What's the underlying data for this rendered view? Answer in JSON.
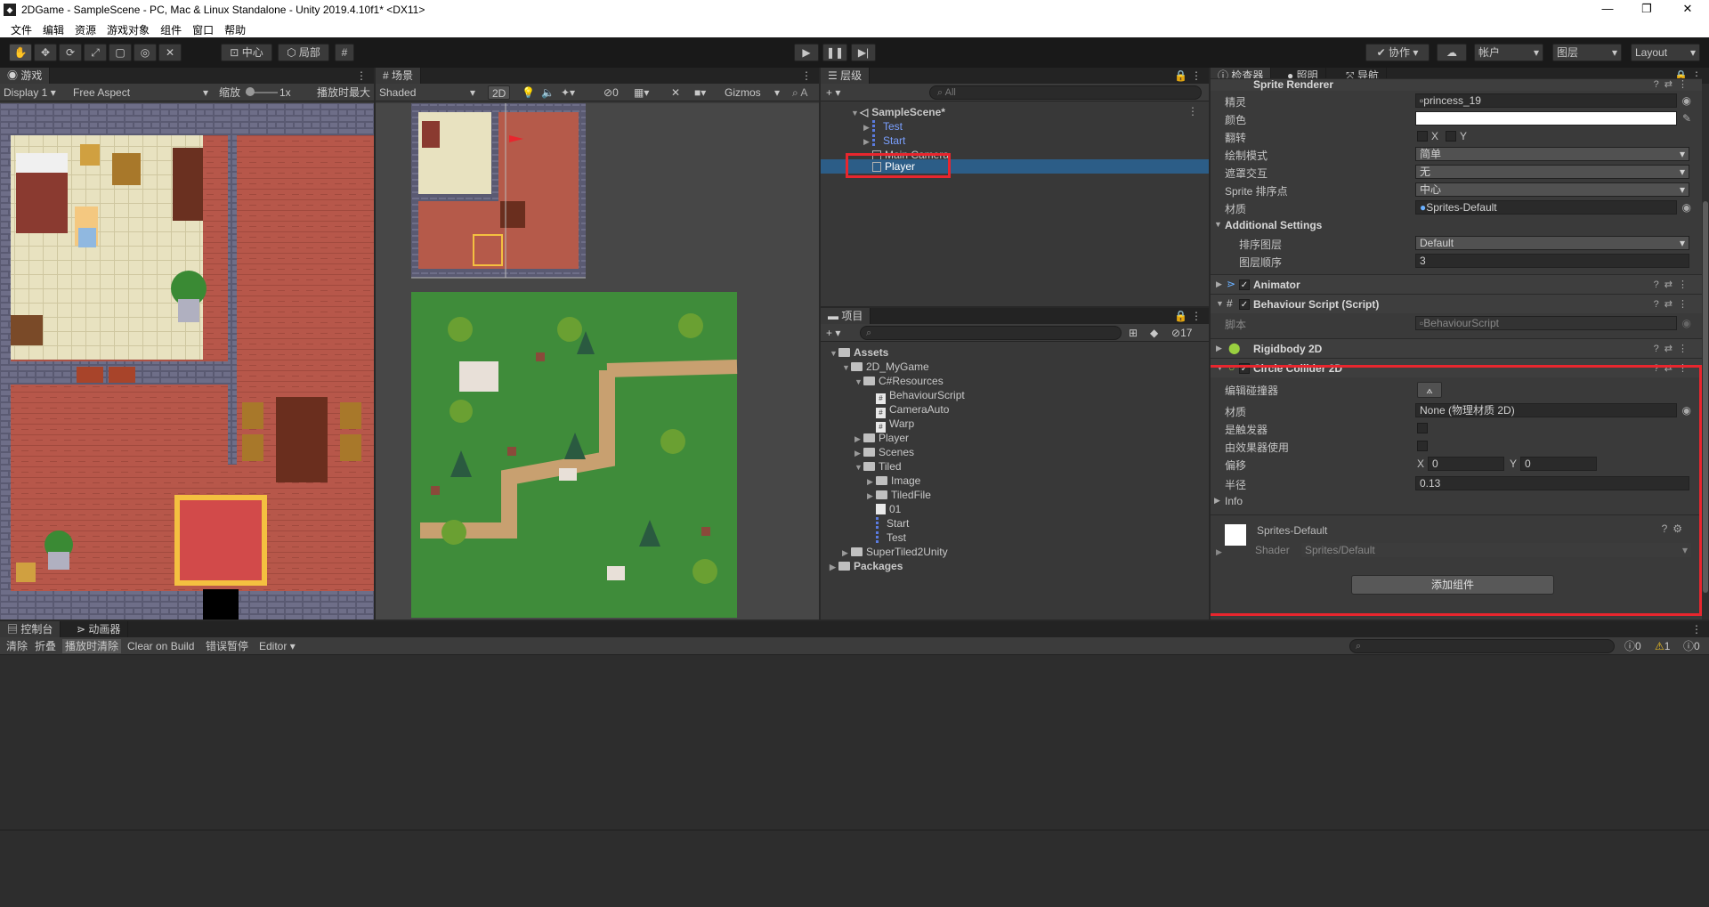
{
  "window": {
    "title": "2DGame - SampleScene - PC, Mac & Linux Standalone - Unity 2019.4.10f1* <DX11>",
    "app_icon": "unity-icon",
    "controls": [
      "—",
      "❐",
      "✕"
    ]
  },
  "menu": [
    "文件",
    "编辑",
    "资源",
    "游戏对象",
    "组件",
    "窗口",
    "帮助"
  ],
  "toolbar": {
    "pivot_label": "中心",
    "space_label": "局部",
    "collab_label": "协作",
    "account_label": "帐户",
    "layers_label": "图层",
    "layout_label": "Layout"
  },
  "game_panel": {
    "tab": "游戏",
    "display": "Display 1",
    "aspect": "Free Aspect",
    "scale_label": "缩放",
    "scale_value": "1x",
    "maximize": "播放时最大"
  },
  "scene_panel": {
    "tab": "场景",
    "shading": "Shaded",
    "mode_2d": "2D",
    "hidden_count": "0",
    "gizmos": "Gizmos",
    "search": "A"
  },
  "hierarchy": {
    "tab": "层级",
    "search_placeholder": "All",
    "scene": "SampleScene*",
    "items": [
      "Test",
      "Start",
      "Main Camera",
      "Player"
    ]
  },
  "project": {
    "tab": "项目",
    "badge": "17",
    "tree": [
      {
        "label": "Assets",
        "depth": 0,
        "open": true,
        "bold": true
      },
      {
        "label": "2D_MyGame",
        "depth": 1,
        "open": true
      },
      {
        "label": "C#Resources",
        "depth": 2,
        "open": true
      },
      {
        "label": "BehaviourScript",
        "depth": 3,
        "type": "script"
      },
      {
        "label": "CameraAuto",
        "depth": 3,
        "type": "script"
      },
      {
        "label": "Warp",
        "depth": 3,
        "type": "script"
      },
      {
        "label": "Player",
        "depth": 2,
        "open": false
      },
      {
        "label": "Scenes",
        "depth": 2,
        "open": false
      },
      {
        "label": "Tiled",
        "depth": 2,
        "open": true
      },
      {
        "label": "Image",
        "depth": 3,
        "open": false
      },
      {
        "label": "TiledFile",
        "depth": 3,
        "open": false
      },
      {
        "label": "01",
        "depth": 3,
        "type": "file"
      },
      {
        "label": "Start",
        "depth": 3,
        "type": "prefab"
      },
      {
        "label": "Test",
        "depth": 3,
        "type": "prefab"
      },
      {
        "label": "SuperTiled2Unity",
        "depth": 1,
        "open": false
      },
      {
        "label": "Packages",
        "depth": 0,
        "open": false,
        "bold": true
      }
    ]
  },
  "inspector": {
    "tabs": [
      "检查器",
      "照明",
      "导航"
    ],
    "sprite_renderer": {
      "name": "Sprite Renderer",
      "sprite_label": "精灵",
      "sprite_value": "princess_19",
      "color_label": "颜色",
      "flip_label": "翻转",
      "flip_x": "X",
      "flip_y": "Y",
      "draw_mode_label": "绘制模式",
      "draw_mode_value": "简单",
      "mask_label": "遮罩交互",
      "mask_value": "无",
      "sort_point_label": "Sprite 排序点",
      "sort_point_value": "中心",
      "material_label": "材质",
      "material_value": "Sprites-Default",
      "additional": "Additional Settings",
      "sort_layer_label": "排序图层",
      "sort_layer_value": "Default",
      "order_label": "图层顺序",
      "order_value": "3"
    },
    "animator": "Animator",
    "behaviour": {
      "name": "Behaviour Script (Script)",
      "script_label": "脚本",
      "script_value": "BehaviourScript"
    },
    "rigidbody": "Rigidbody 2D",
    "circle_collider": {
      "name": "Circle Collider 2D",
      "edit_label": "编辑碰撞器",
      "material_label": "材质",
      "material_value": "None (物理材质 2D)",
      "trigger_label": "是触发器",
      "effector_label": "由效果器使用",
      "offset_label": "偏移",
      "offset_x_label": "X",
      "offset_x": "0",
      "offset_y_label": "Y",
      "offset_y": "0",
      "radius_label": "半径",
      "radius_value": "0.13",
      "info_label": "Info"
    },
    "material_block": {
      "name": "Sprites-Default",
      "shader_label": "Shader",
      "shader_value": "Sprites/Default"
    },
    "add_component": "添加组件"
  },
  "console": {
    "tabs": [
      "控制台",
      "动画器"
    ],
    "buttons": [
      "清除",
      "折叠",
      "播放时清除",
      "Clear on Build",
      "错误暂停",
      "Editor"
    ],
    "counts": {
      "log": "0",
      "warn": "1",
      "error": "0"
    }
  },
  "colors": {
    "highlight_red": "#e8262e",
    "selection_blue": "#2c5d87",
    "panel_bg": "#383838",
    "dark_bg": "#282828",
    "grass": "#3f8c3a",
    "floor": "#b55a4a"
  }
}
